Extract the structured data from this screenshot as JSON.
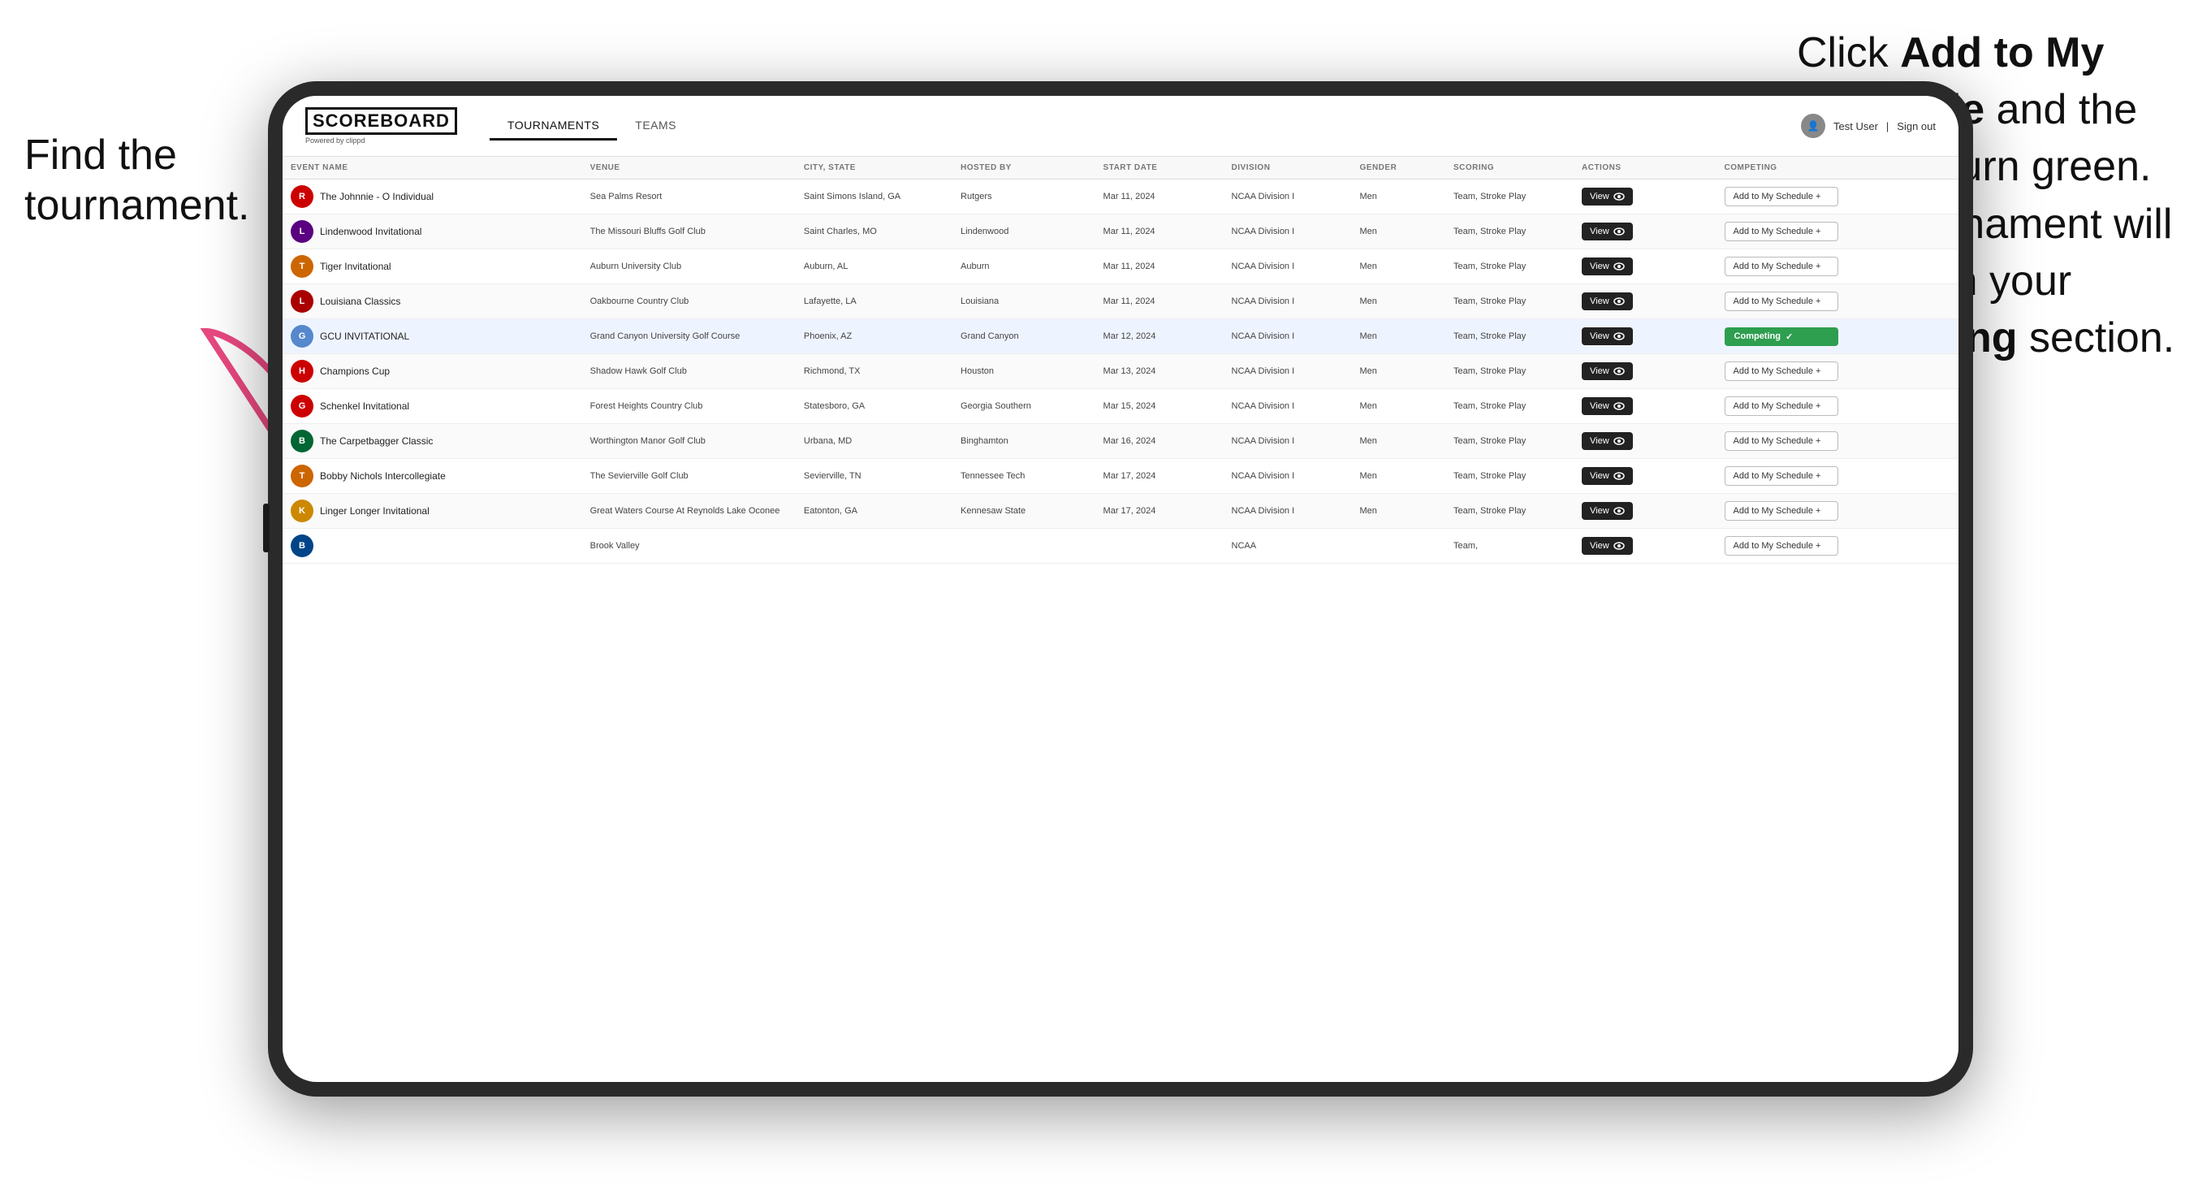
{
  "annotations": {
    "left": "Find the tournament.",
    "right_line1": "Click ",
    "right_bold1": "Add to My Schedule",
    "right_line2": " and the box will turn green. This tournament will now be in your ",
    "right_bold2": "Competing",
    "right_line3": " section."
  },
  "nav": {
    "logo": "SCOREBOARD",
    "logo_sub": "Powered by clippd",
    "tabs": [
      "TOURNAMENTS",
      "TEAMS"
    ],
    "active_tab": "TOURNAMENTS",
    "user": "Test User",
    "signout": "Sign out"
  },
  "table": {
    "headers": [
      "EVENT NAME",
      "VENUE",
      "CITY, STATE",
      "HOSTED BY",
      "START DATE",
      "DIVISION",
      "GENDER",
      "SCORING",
      "ACTIONS",
      "COMPETING"
    ],
    "rows": [
      {
        "logo_letter": "R",
        "logo_color": "#cc0000",
        "event": "The Johnnie - O Individual",
        "venue": "Sea Palms Resort",
        "city": "Saint Simons Island, GA",
        "hosted": "Rutgers",
        "date": "Mar 11, 2024",
        "division": "NCAA Division I",
        "gender": "Men",
        "scoring": "Team, Stroke Play",
        "action": "View",
        "competing_type": "add",
        "competing_label": "Add to My Schedule +"
      },
      {
        "logo_letter": "L",
        "logo_color": "#5a0080",
        "event": "Lindenwood Invitational",
        "venue": "The Missouri Bluffs Golf Club",
        "city": "Saint Charles, MO",
        "hosted": "Lindenwood",
        "date": "Mar 11, 2024",
        "division": "NCAA Division I",
        "gender": "Men",
        "scoring": "Team, Stroke Play",
        "action": "View",
        "competing_type": "add",
        "competing_label": "Add to My Schedule +"
      },
      {
        "logo_letter": "T",
        "logo_color": "#cc6600",
        "event": "Tiger Invitational",
        "venue": "Auburn University Club",
        "city": "Auburn, AL",
        "hosted": "Auburn",
        "date": "Mar 11, 2024",
        "division": "NCAA Division I",
        "gender": "Men",
        "scoring": "Team, Stroke Play",
        "action": "View",
        "competing_type": "add",
        "competing_label": "Add to My Schedule +"
      },
      {
        "logo_letter": "L",
        "logo_color": "#aa0000",
        "event": "Louisiana Classics",
        "venue": "Oakbourne Country Club",
        "city": "Lafayette, LA",
        "hosted": "Louisiana",
        "date": "Mar 11, 2024",
        "division": "NCAA Division I",
        "gender": "Men",
        "scoring": "Team, Stroke Play",
        "action": "View",
        "competing_type": "add",
        "competing_label": "Add to My Schedule +"
      },
      {
        "logo_letter": "G",
        "logo_color": "#5588cc",
        "event": "GCU INVITATIONAL",
        "venue": "Grand Canyon University Golf Course",
        "city": "Phoenix, AZ",
        "hosted": "Grand Canyon",
        "date": "Mar 12, 2024",
        "division": "NCAA Division I",
        "gender": "Men",
        "scoring": "Team, Stroke Play",
        "action": "View",
        "competing_type": "competing",
        "competing_label": "Competing ✓",
        "highlight": true
      },
      {
        "logo_letter": "H",
        "logo_color": "#cc0000",
        "event": "Champions Cup",
        "venue": "Shadow Hawk Golf Club",
        "city": "Richmond, TX",
        "hosted": "Houston",
        "date": "Mar 13, 2024",
        "division": "NCAA Division I",
        "gender": "Men",
        "scoring": "Team, Stroke Play",
        "action": "View",
        "competing_type": "add",
        "competing_label": "Add to My Schedule +"
      },
      {
        "logo_letter": "G",
        "logo_color": "#cc0000",
        "event": "Schenkel Invitational",
        "venue": "Forest Heights Country Club",
        "city": "Statesboro, GA",
        "hosted": "Georgia Southern",
        "date": "Mar 15, 2024",
        "division": "NCAA Division I",
        "gender": "Men",
        "scoring": "Team, Stroke Play",
        "action": "View",
        "competing_type": "add",
        "competing_label": "Add to My Schedule +"
      },
      {
        "logo_letter": "B",
        "logo_color": "#006633",
        "event": "The Carpetbagger Classic",
        "venue": "Worthington Manor Golf Club",
        "city": "Urbana, MD",
        "hosted": "Binghamton",
        "date": "Mar 16, 2024",
        "division": "NCAA Division I",
        "gender": "Men",
        "scoring": "Team, Stroke Play",
        "action": "View",
        "competing_type": "add",
        "competing_label": "Add to My Schedule +"
      },
      {
        "logo_letter": "T",
        "logo_color": "#cc6600",
        "event": "Bobby Nichols Intercollegiate",
        "venue": "The Sevierville Golf Club",
        "city": "Sevierville, TN",
        "hosted": "Tennessee Tech",
        "date": "Mar 17, 2024",
        "division": "NCAA Division I",
        "gender": "Men",
        "scoring": "Team, Stroke Play",
        "action": "View",
        "competing_type": "add",
        "competing_label": "Add to My Schedule +"
      },
      {
        "logo_letter": "K",
        "logo_color": "#cc8800",
        "event": "Linger Longer Invitational",
        "venue": "Great Waters Course At Reynolds Lake Oconee",
        "city": "Eatonton, GA",
        "hosted": "Kennesaw State",
        "date": "Mar 17, 2024",
        "division": "NCAA Division I",
        "gender": "Men",
        "scoring": "Team, Stroke Play",
        "action": "View",
        "competing_type": "add",
        "competing_label": "Add to My Schedule +"
      },
      {
        "logo_letter": "B",
        "logo_color": "#004488",
        "event": "",
        "venue": "Brook Valley",
        "city": "",
        "hosted": "",
        "date": "",
        "division": "NCAA",
        "gender": "",
        "scoring": "Team,",
        "action": "View",
        "competing_type": "add",
        "competing_label": "Add to My Schedule +"
      }
    ]
  },
  "colors": {
    "competing_green": "#2e9e4f",
    "arrow_pink": "#e84880",
    "highlight_row": "#eef4ff"
  }
}
